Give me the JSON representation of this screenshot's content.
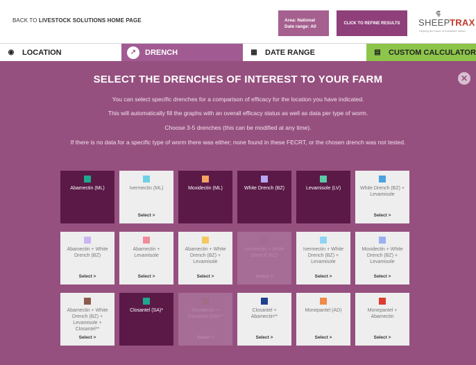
{
  "header": {
    "back_prefix": "BACK TO ",
    "back_bold": "LIVESTOCK SOLUTIONS HOME PAGE",
    "area_line1": "Area: National",
    "area_line2": "Date range: All",
    "refine_label": "CLICK TO REFINE RESULTS",
    "logo_word1": "SHEEP",
    "logo_word2": "TRAX",
    "logo_tagline": "Helping the future of Australian sheep"
  },
  "tabs": [
    {
      "label": "LOCATION",
      "icon": "location-pin-icon"
    },
    {
      "label": "DRENCH",
      "icon": "syringe-icon"
    },
    {
      "label": "DATE RANGE",
      "icon": "calendar-icon"
    },
    {
      "label": "CUSTOM CALCULATOR",
      "icon": "calculator-icon"
    }
  ],
  "panel": {
    "title": "SELECT THE DRENCHES OF INTEREST TO YOUR FARM",
    "lines": [
      "You can select specific drenches for a comparison of efficacy for the location you have indicated.",
      "This will automatically fill the graphs with an overall efficacy status as well as data per type of worm.",
      "Choose 3-5 drenches (this can be modified at any time).",
      "If there is no data for a specific type of worm there was either; none found in these FECRT, or the chosen drench was not tested."
    ]
  },
  "drenches": [
    {
      "name": "Abamectin (ML)",
      "color": "#1fa88f",
      "state": "selected",
      "select": ""
    },
    {
      "name": "Ivermectin (ML)",
      "color": "#6fd0e6",
      "state": "unselected",
      "select": "Select >"
    },
    {
      "name": "Moxidectin (ML)",
      "color": "#f4a261",
      "state": "selected",
      "select": ""
    },
    {
      "name": "White Drench (BZ)",
      "color": "#b7a6f0",
      "state": "selected",
      "select": ""
    },
    {
      "name": "Levamisole (LV)",
      "color": "#5cc9a7",
      "state": "selected",
      "select": ""
    },
    {
      "name": "White Drench (BZ) + Levamisole",
      "color": "#4aa3df",
      "state": "unselected",
      "select": "Select >"
    },
    {
      "name": "Abamectin + White Drench (BZ)",
      "color": "#c8b6f2",
      "state": "unselected",
      "select": "Select >"
    },
    {
      "name": "Abamectin + Levamisole",
      "color": "#f28b9b",
      "state": "unselected",
      "select": "Select >"
    },
    {
      "name": "Abamectin + White Drench (BZ) + Levamisole",
      "color": "#f6c85f",
      "state": "unselected",
      "select": "Select >"
    },
    {
      "name": "Ivermectin + White Drench (BZ)",
      "color": "#9a6b8b",
      "state": "disabled",
      "select": "Select >"
    },
    {
      "name": "Ivermectin + White Drench (BZ) + Levamisole",
      "color": "#8fd3f5",
      "state": "unselected",
      "select": "Select >"
    },
    {
      "name": "Moxidectin + White Drench (BZ) + Levamisole",
      "color": "#9ab0f0",
      "state": "unselected",
      "select": "Select >"
    },
    {
      "name": "Abamectin + White Drench (BZ) + Levamisole + Closantel**",
      "color": "#8b5a4a",
      "state": "unselected",
      "select": "Select >"
    },
    {
      "name": "Closantel (SA)*",
      "color": "#1fa88f",
      "state": "selected",
      "select": ""
    },
    {
      "name": "Moxidectin + Closantel (SA)**",
      "color": "#9a6b7b",
      "state": "disabled",
      "select": "Select >"
    },
    {
      "name": "Closantel + Abamectin**",
      "color": "#1f3f8f",
      "state": "unselected",
      "select": "Select >"
    },
    {
      "name": "Monepantel (AD)",
      "color": "#f08a4b",
      "state": "unselected",
      "select": "Select >"
    },
    {
      "name": "Monepantel + Abamectin",
      "color": "#e03a2f",
      "state": "unselected",
      "select": "Select >"
    }
  ]
}
